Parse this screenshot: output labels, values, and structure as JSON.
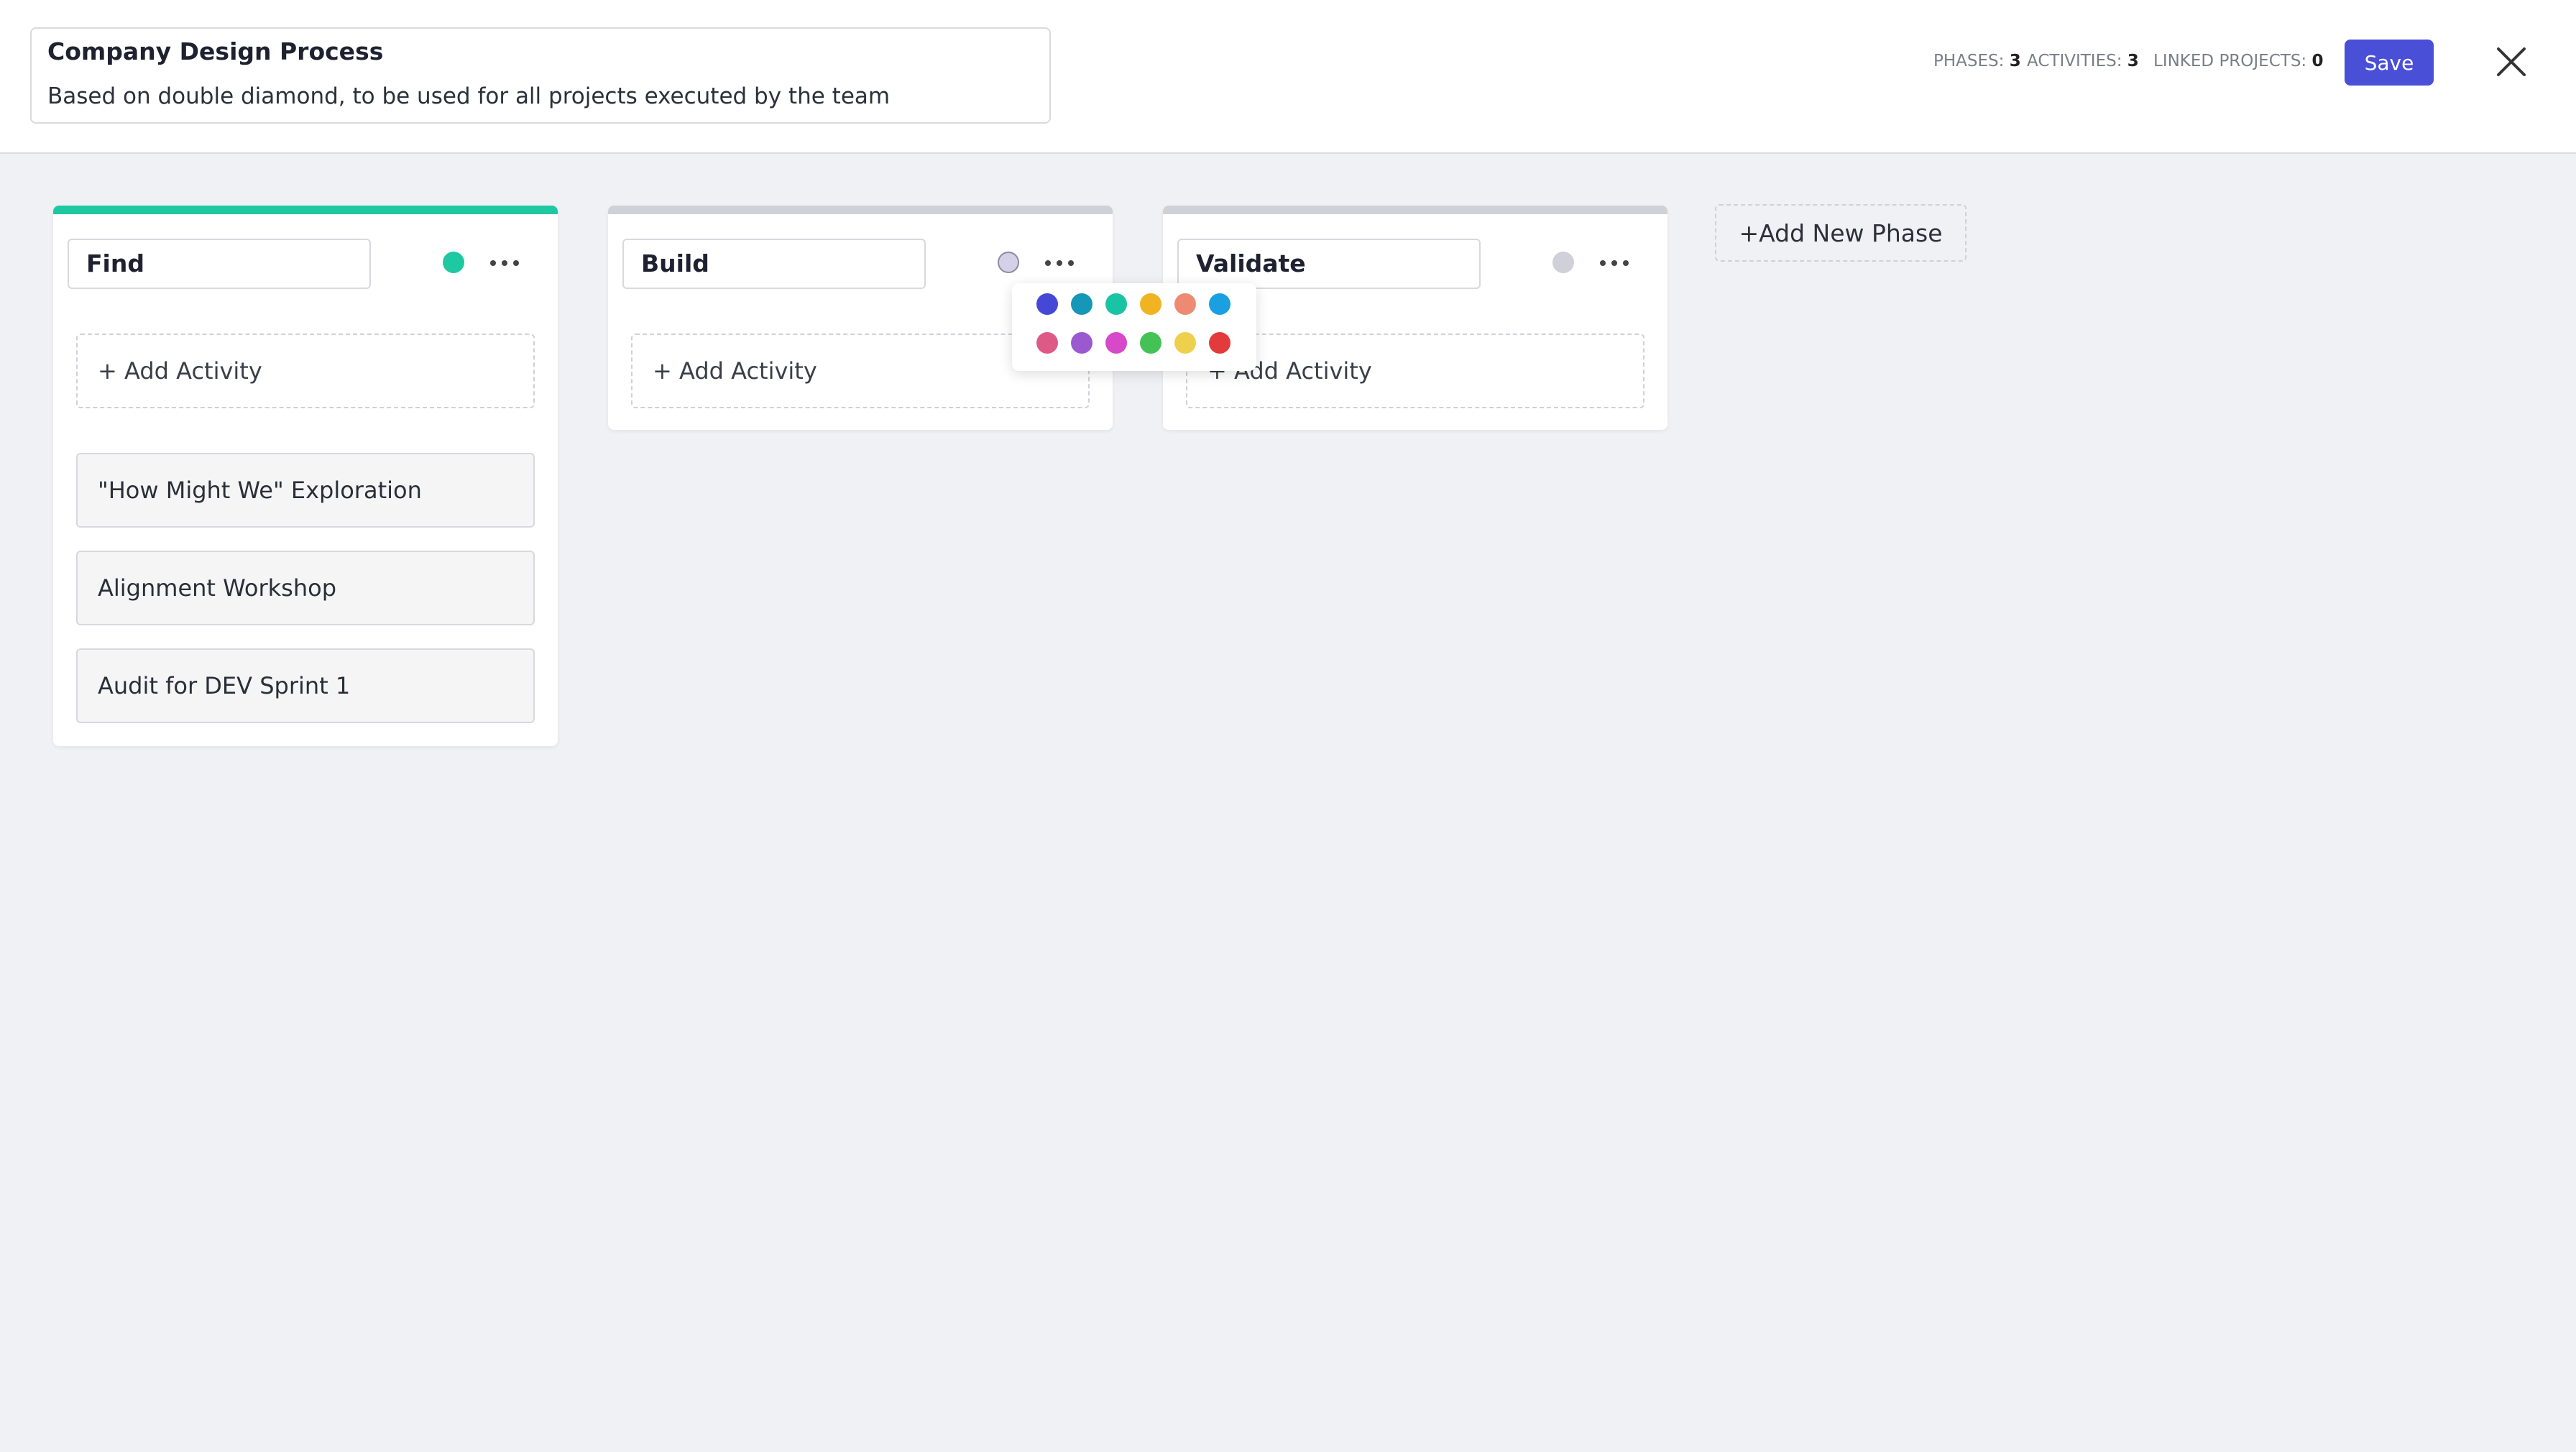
{
  "process": {
    "title": "Company Design Process",
    "description": "Based on double diamond, to be used for all projects executed by the team"
  },
  "stats": {
    "phases_label": "PHASES:",
    "phases_value": "3",
    "activities_label": "ACTIVITIES:",
    "activities_value": "3",
    "linked_label": "LINKED PROJECTS:",
    "linked_value": "0"
  },
  "save_label": "Save",
  "colors": {
    "accent": "#4a4fd8",
    "find_phase": "#1ec9a2",
    "inactive_bar": "#cfd0d8"
  },
  "phases": [
    {
      "name": "Find",
      "color": "#1ec9a2",
      "add_activity_label": "+ Add Activity",
      "activities": [
        "\"How Might We\" Exploration",
        "Alignment Workshop",
        "Audit for DEV Sprint 1"
      ]
    },
    {
      "name": "Build",
      "color": "#d3d0e8",
      "add_activity_label": "+ Add Activity",
      "activities": []
    },
    {
      "name": "Validate",
      "color": "#cfd0d8",
      "add_activity_label": "+ Add Activity",
      "activities": []
    }
  ],
  "add_phase_label": "+Add New Phase",
  "color_picker": {
    "swatches": [
      "#4548d6",
      "#1597b8",
      "#19c4a4",
      "#f0b321",
      "#ee8a72",
      "#1aa0e0",
      "#de5a86",
      "#9b59d0",
      "#d749c8",
      "#45c256",
      "#eed04c",
      "#e33b3b"
    ]
  }
}
